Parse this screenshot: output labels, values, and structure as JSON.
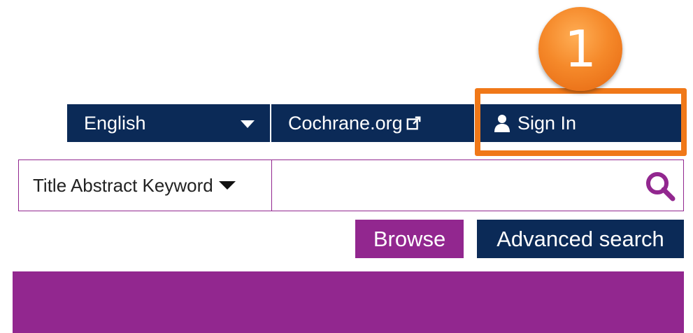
{
  "topbar": {
    "language_label": "English",
    "cochrane_link": "Cochrane.org",
    "signin_label": "Sign In"
  },
  "callout": {
    "number": "1"
  },
  "search": {
    "field_label": "Title Abstract Keyword",
    "query_value": "",
    "placeholder": ""
  },
  "actions": {
    "browse_label": "Browse",
    "advanced_label": "Advanced search"
  },
  "icons": {
    "language_dropdown": "caret-down-icon",
    "cochrane_link": "external-link-icon",
    "signin": "user-icon",
    "field_dropdown": "caret-down-icon",
    "search": "search-icon"
  },
  "colors": {
    "navy": "#0b2a57",
    "purple": "#92278f",
    "callout_orange": "#f07818"
  }
}
